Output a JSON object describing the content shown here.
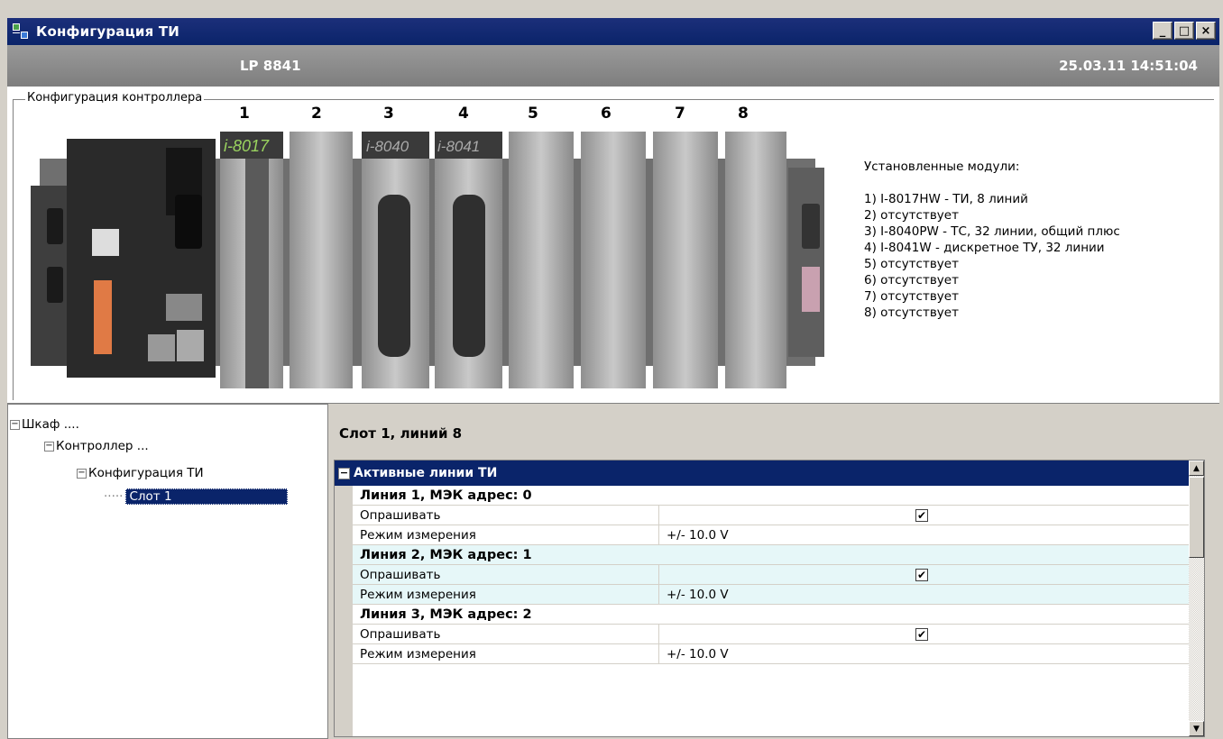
{
  "window": {
    "title": "Конфигурация ТИ",
    "buttons": {
      "minimize": "_",
      "maximize": "□",
      "close": "×"
    }
  },
  "header": {
    "device": "LP 8841",
    "datetime": "25.03.11 14:51:04"
  },
  "config": {
    "legend": "Конфигурация контроллера",
    "slot_numbers": [
      "1",
      "2",
      "3",
      "4",
      "5",
      "6",
      "7",
      "8"
    ],
    "module_badges": [
      "i-8017",
      "i-8040",
      "i-8041"
    ],
    "modules_title": "Установленные модули:",
    "modules": [
      "1) I-8017HW - ТИ, 8 линий",
      "2) отсутствует",
      "3) I-8040PW - ТС, 32 линии, общий плюс",
      "4) I-8041W - дискретное ТУ, 32 линии",
      "5) отсутствует",
      "6) отсутствует",
      "7) отсутствует",
      "8) отсутствует"
    ]
  },
  "tree": [
    {
      "label": "Шкаф ....",
      "toggle": "−"
    },
    {
      "label": "Контроллер ...",
      "toggle": "−"
    },
    {
      "label": "Конфигурация ТИ",
      "toggle": "−"
    },
    {
      "label": "Слот 1",
      "selected": true
    }
  ],
  "details": {
    "slot_header": "Слот 1, линий 8",
    "category": "Активные линии ТИ",
    "category_toggle": "−",
    "rows": [
      {
        "type": "header",
        "label": "Линия 1, МЭК адрес: 0"
      },
      {
        "type": "prop",
        "name": "Опрашивать",
        "checked": true,
        "check_glyph": "✔"
      },
      {
        "type": "prop",
        "name": "Режим измерения",
        "value": "+/- 10.0 V"
      },
      {
        "type": "header",
        "label": "Линия 2, МЭК адрес: 1"
      },
      {
        "type": "prop",
        "name": "Опрашивать",
        "checked": true,
        "check_glyph": "✔"
      },
      {
        "type": "prop",
        "name": "Режим измерения",
        "value": "+/- 10.0 V"
      },
      {
        "type": "header",
        "label": "Линия 3, МЭК адрес: 2"
      },
      {
        "type": "prop",
        "name": "Опрашивать",
        "checked": true,
        "check_glyph": "✔"
      },
      {
        "type": "prop",
        "name": "Режим измерения",
        "value": "+/- 10.0 V"
      }
    ]
  },
  "scrollbar": {
    "up": "▲",
    "down": "▼"
  }
}
